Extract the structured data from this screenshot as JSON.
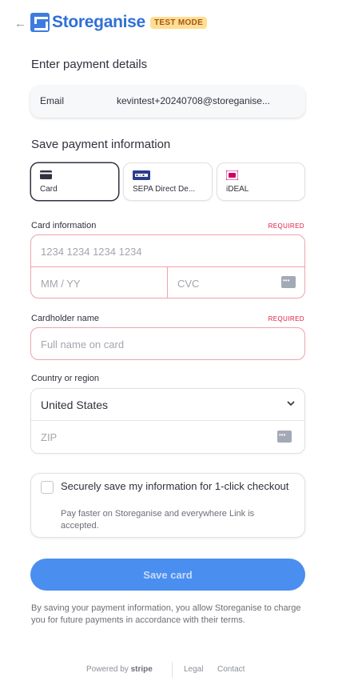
{
  "header": {
    "back_symbol": "←",
    "brand": "Storeganise",
    "test_mode": "TEST MODE"
  },
  "payment": {
    "title": "Enter payment details",
    "email_label": "Email",
    "email_value": "kevintest+20240708@storeganise..."
  },
  "save_info": {
    "title": "Save payment information",
    "methods": [
      {
        "label": "Card",
        "icon": "card-icon",
        "selected": true
      },
      {
        "label": "SEPA Direct De...",
        "icon": "sepa-icon",
        "selected": false
      },
      {
        "label": "iDEAL",
        "icon": "ideal-icon",
        "selected": false
      }
    ]
  },
  "card": {
    "label": "Card information",
    "required": "REQUIRED",
    "number_placeholder": "1234 1234 1234 1234",
    "expiry_placeholder": "MM / YY",
    "cvc_placeholder": "CVC"
  },
  "cardholder": {
    "label": "Cardholder name",
    "required": "REQUIRED",
    "placeholder": "Full name on card"
  },
  "country": {
    "label": "Country or region",
    "value": "United States",
    "zip_placeholder": "ZIP"
  },
  "link": {
    "title": "Securely save my information for 1-click checkout",
    "description": "Pay faster on Storeganise and everywhere Link is accepted.",
    "checked": false
  },
  "submit": {
    "label": "Save card"
  },
  "consent": "By saving your payment information, you allow Storeganise to charge you for future payments in accordance with their terms.",
  "footer": {
    "powered_by": "Powered by",
    "stripe": "stripe",
    "legal": "Legal",
    "contact": "Contact"
  },
  "colors": {
    "accent": "#4a8eef",
    "brand": "#2f6fd6",
    "error_border": "#f0a2ae",
    "required": "#df1b41",
    "badge_bg": "#ffde92"
  }
}
